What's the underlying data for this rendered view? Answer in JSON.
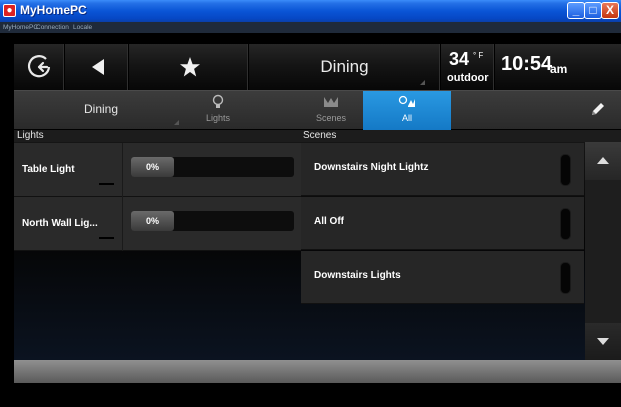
{
  "window": {
    "title": "MyHomePC",
    "controls": {
      "minimize": "_",
      "maximize": "□",
      "close": "X"
    }
  },
  "menu": [
    {
      "label": "MyHomePC"
    },
    {
      "label": "Connection"
    },
    {
      "label": "Locale"
    }
  ],
  "topbar": {
    "home_icon": "home-g-icon",
    "back_icon": "back-arrow-icon",
    "favorite_icon": "star-icon",
    "room_title": "Dining",
    "weather": {
      "temp": "34",
      "unit": "° F",
      "label": "outdoor"
    },
    "clock": {
      "time": "10:54",
      "ampm": "am"
    }
  },
  "tabbar": {
    "room_select": "Dining",
    "tabs": [
      {
        "label": "Lights",
        "icon": "lightbulb-icon",
        "active": false
      },
      {
        "label": "Scenes",
        "icon": "scenes-icon",
        "active": false
      },
      {
        "label": "All",
        "icon": "all-icon",
        "active": true
      }
    ],
    "edit_icon": "pencil-icon"
  },
  "lights": {
    "header": "Lights",
    "items": [
      {
        "name": "Table Light",
        "level": "0%",
        "level_value": 0
      },
      {
        "name": "North Wall Lig...",
        "level": "0%",
        "level_value": 0
      }
    ]
  },
  "scenes": {
    "header": "Scenes",
    "items": [
      {
        "name": "Downstairs Night Lightz"
      },
      {
        "name": "All Off"
      },
      {
        "name": "Downstairs Lights"
      }
    ]
  },
  "colors": {
    "accent": "#1e88d4",
    "titlebar": "#0a55d6"
  }
}
